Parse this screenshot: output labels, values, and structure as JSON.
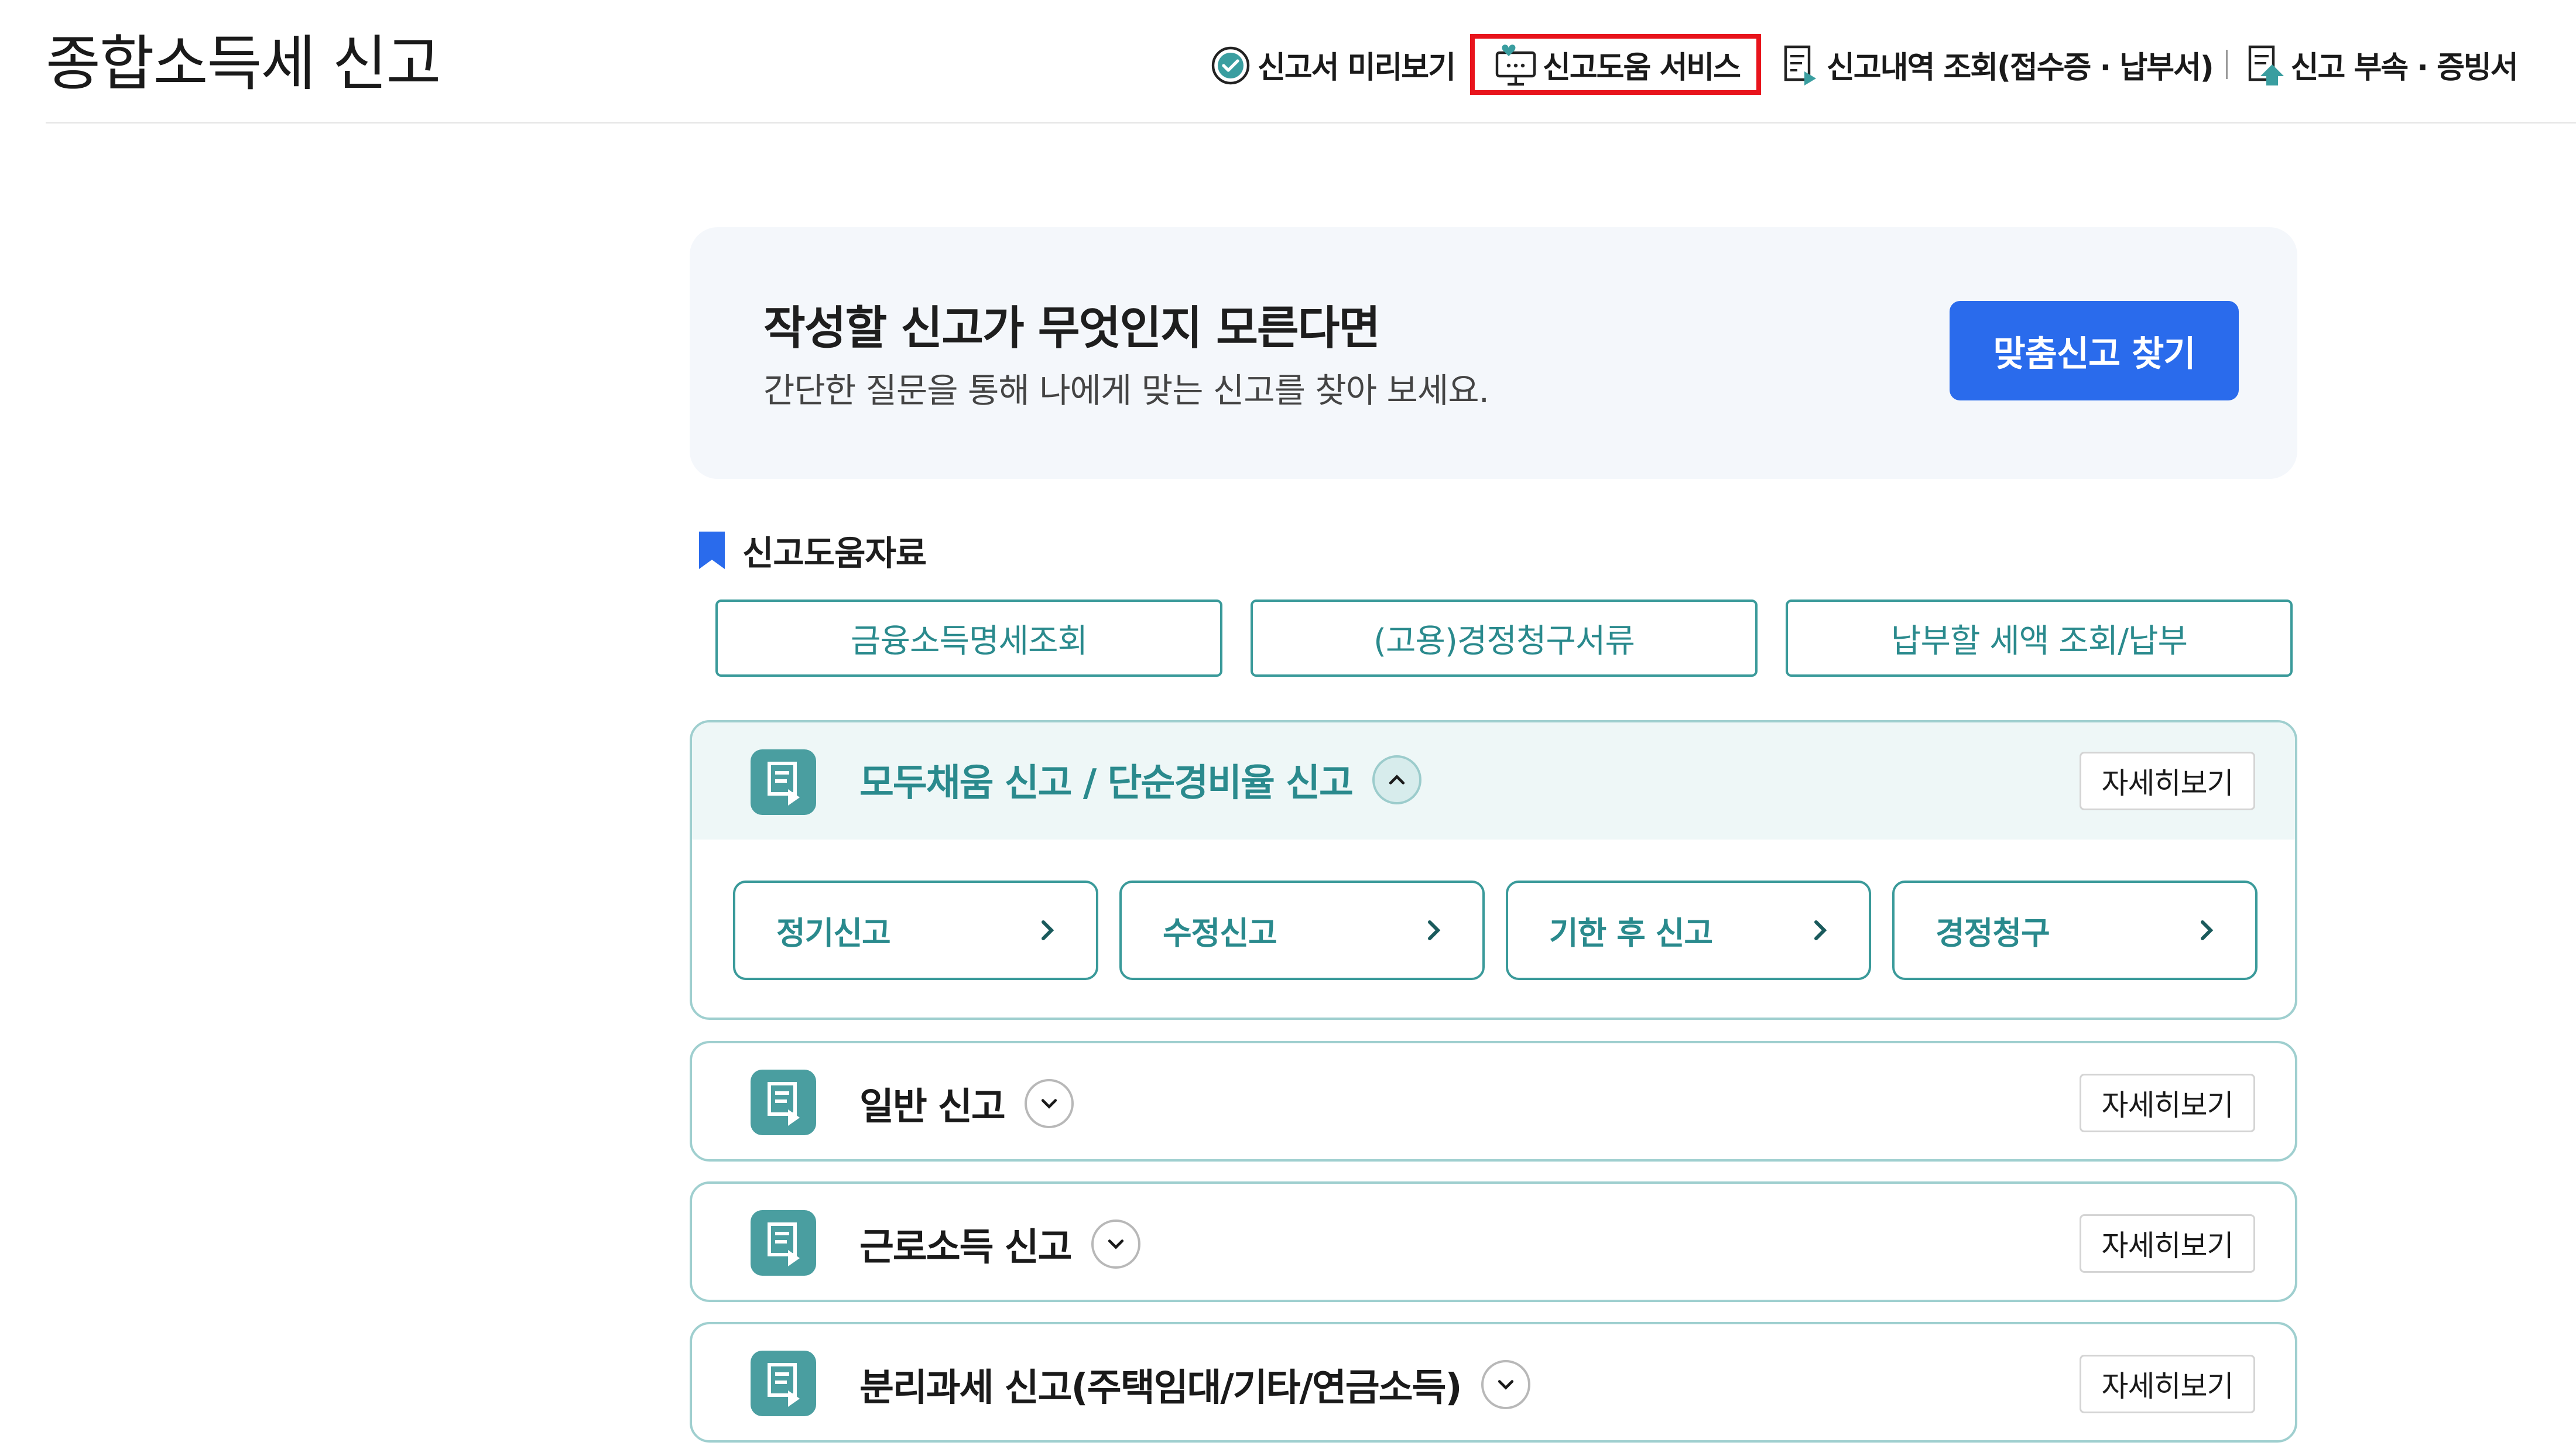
{
  "header": {
    "title": "종합소득세 신고",
    "nav": [
      {
        "label": "신고서 미리보기",
        "icon": "check-circle-icon"
      },
      {
        "label": "신고도움 서비스",
        "icon": "help-monitor-icon",
        "highlighted": true
      },
      {
        "label": "신고내역 조회(접수증 · 납부서)",
        "icon": "document-search-icon"
      },
      {
        "label": "신고 부속 · 증빙서",
        "icon": "document-upload-icon"
      }
    ],
    "highlight_color": "#e8141c"
  },
  "banner": {
    "title": "작성할 신고가 무엇인지 모른다면",
    "subtitle": "간단한 질문을 통해 나에게 맞는 신고를 찾아 보세요.",
    "button_label": "맞춤신고 찾기",
    "button_color": "#2a6bec"
  },
  "help": {
    "title": "신고도움자료",
    "icon": "bookmark-icon",
    "buttons": [
      "금융소득명세조회",
      "(고용)경정청구서류",
      "납부할 세액 조회/납부"
    ]
  },
  "filings": [
    {
      "title": "모두채움 신고 / 단순경비율 신고",
      "detail_label": "자세히보기",
      "expanded": true,
      "options": [
        "정기신고",
        "수정신고",
        "기한 후 신고",
        "경정청구"
      ]
    },
    {
      "title": "일반 신고",
      "detail_label": "자세히보기",
      "expanded": false
    },
    {
      "title": "근로소득 신고",
      "detail_label": "자세히보기",
      "expanded": false
    },
    {
      "title": "분리과세 신고(주택임대/기타/연금소득)",
      "detail_label": "자세히보기",
      "expanded": false
    }
  ],
  "colors": {
    "accent_teal": "#2a8a8d",
    "card_border": "#9fcfcf",
    "icon_teal": "#4a9ea0"
  }
}
